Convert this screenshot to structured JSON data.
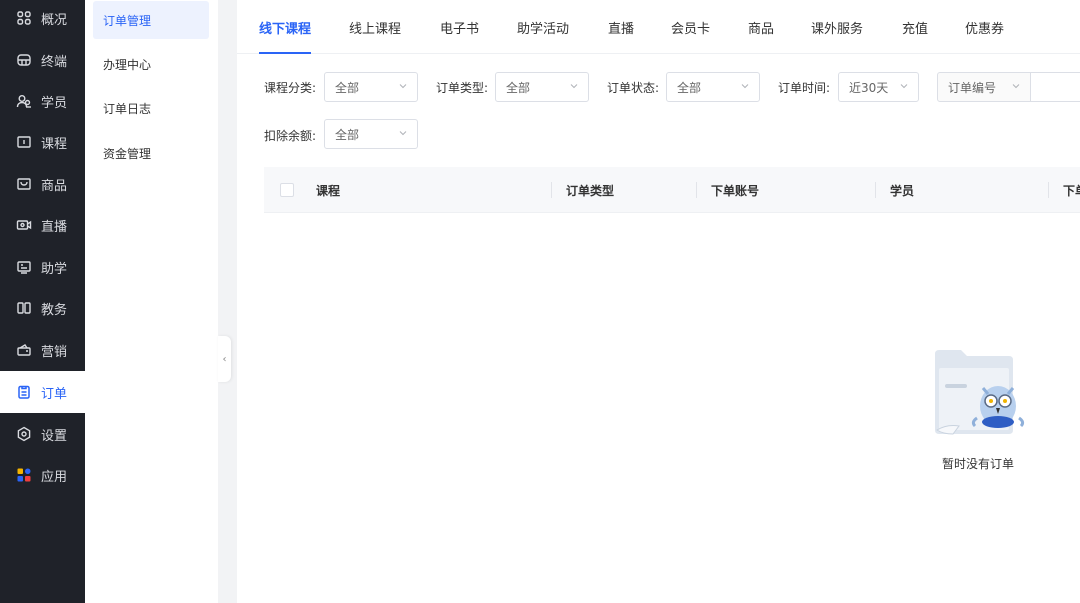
{
  "nav": {
    "items": [
      {
        "label": "概况"
      },
      {
        "label": "终端"
      },
      {
        "label": "学员"
      },
      {
        "label": "课程"
      },
      {
        "label": "商品"
      },
      {
        "label": "直播"
      },
      {
        "label": "助学"
      },
      {
        "label": "教务"
      },
      {
        "label": "营销"
      },
      {
        "label": "订单"
      },
      {
        "label": "设置"
      },
      {
        "label": "应用"
      }
    ]
  },
  "submenu": {
    "items": [
      {
        "label": "订单管理"
      },
      {
        "label": "办理中心"
      },
      {
        "label": "订单日志"
      },
      {
        "label": "资金管理"
      }
    ]
  },
  "tabs": [
    {
      "label": "线下课程"
    },
    {
      "label": "线上课程"
    },
    {
      "label": "电子书"
    },
    {
      "label": "助学活动"
    },
    {
      "label": "直播"
    },
    {
      "label": "会员卡"
    },
    {
      "label": "商品"
    },
    {
      "label": "课外服务"
    },
    {
      "label": "充值"
    },
    {
      "label": "优惠券"
    }
  ],
  "filters": {
    "category": {
      "label": "课程分类:",
      "value": "全部"
    },
    "order_type": {
      "label": "订单类型:",
      "value": "全部"
    },
    "order_status": {
      "label": "订单状态:",
      "value": "全部"
    },
    "order_time": {
      "label": "订单时间:",
      "value": "近30天"
    },
    "order_no": {
      "value": "订单编号"
    },
    "deduct_balance": {
      "label": "扣除余额:",
      "value": "全部"
    }
  },
  "table": {
    "columns": [
      "课程",
      "订单类型",
      "下单账号",
      "学员",
      "下单"
    ]
  },
  "empty": {
    "text": "暂时没有订单"
  },
  "colors": {
    "accent": "#2a64f6",
    "nav_bg": "#1f2229"
  }
}
